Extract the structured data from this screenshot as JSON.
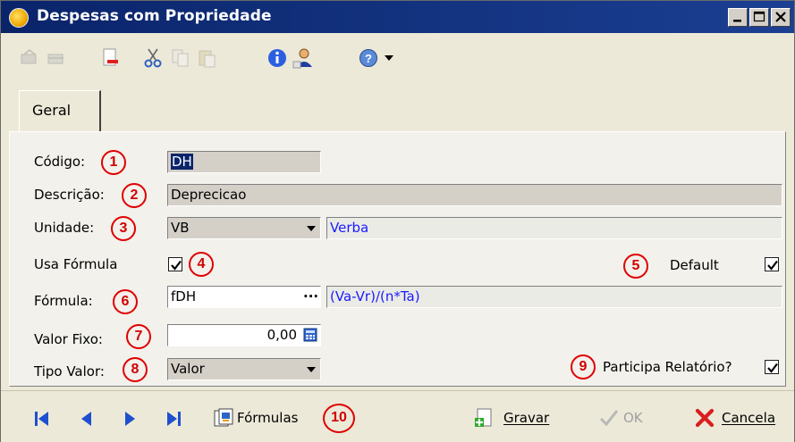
{
  "window": {
    "title": "Despesas com Propriedade",
    "min_label": "_",
    "max_label": "□",
    "close_label": "X"
  },
  "toolbar": {
    "icons": [
      "undo-icon",
      "redo-icon",
      "new-document-icon",
      "cut-icon",
      "copy-icon",
      "paste-icon",
      "info-icon",
      "user-icon",
      "help-icon",
      "dropdown-arrow-icon"
    ]
  },
  "tabs": [
    {
      "label": "Geral"
    }
  ],
  "form": {
    "codigo": {
      "label": "Código:",
      "marker": "1",
      "value": "DH"
    },
    "descricao": {
      "label": "Descrição:",
      "marker": "2",
      "value": "Deprecicao"
    },
    "unidade": {
      "label": "Unidade:",
      "marker": "3",
      "value": "VB",
      "description": "Verba"
    },
    "usa_formula": {
      "label": "Usa Fórmula",
      "marker": "4",
      "checked": true
    },
    "default": {
      "label": "Default",
      "marker": "5",
      "checked": true
    },
    "formula": {
      "label": "Fórmula:",
      "marker": "6",
      "value": "fDH",
      "ellipsis": "···",
      "expression": "(Va-Vr)/(n*Ta)"
    },
    "valor_fixo": {
      "label": "Valor Fixo:",
      "marker": "7",
      "value": "0,00"
    },
    "tipo_valor": {
      "label": "Tipo Valor:",
      "marker": "8",
      "value": "Valor"
    },
    "participa_relatorio": {
      "label": "Participa Relatório?",
      "marker": "9",
      "checked": true
    }
  },
  "bottom": {
    "formulas_label": "Fórmulas",
    "formulas_marker": "10",
    "gravar_label": "Gravar",
    "ok_label": "OK",
    "cancela_label": "Cancela"
  },
  "colors": {
    "titlebar": "#0a246a",
    "marker_red": "#e00000",
    "link_blue": "#1a1aff",
    "selection": "#0a246a",
    "nav_blue": "#1f4fcf",
    "cancel_red": "#d81e1e"
  }
}
